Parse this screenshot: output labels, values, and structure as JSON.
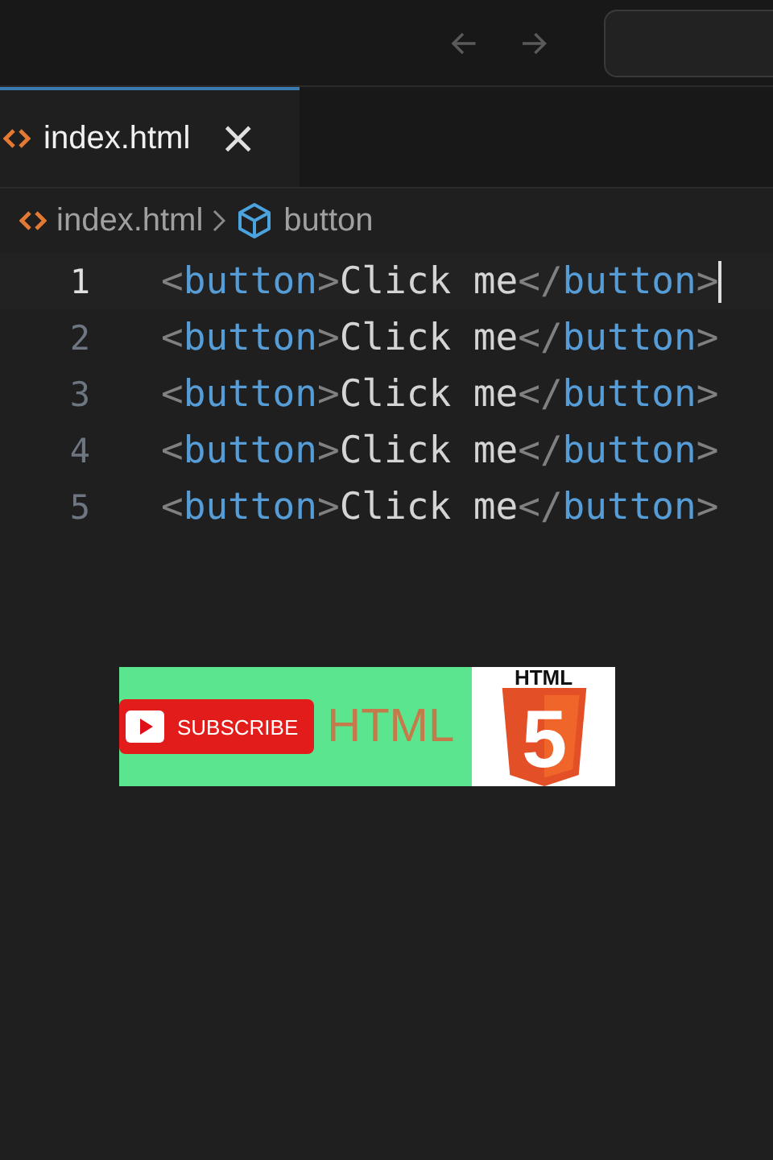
{
  "tab": {
    "label": "index.html",
    "selected": true,
    "close": "×"
  },
  "breadcrumb": {
    "file": "index.html",
    "symbol": "button"
  },
  "editor": {
    "lines": [
      {
        "number": "1",
        "active": true,
        "tokens": [
          {
            "kind": "punct",
            "text": "<"
          },
          {
            "kind": "tag",
            "text": "button"
          },
          {
            "kind": "punct",
            "text": ">"
          },
          {
            "kind": "text",
            "text": "Click me"
          },
          {
            "kind": "punct",
            "text": "</"
          },
          {
            "kind": "tag",
            "text": "button"
          },
          {
            "kind": "punct",
            "text": ">"
          }
        ]
      },
      {
        "number": "2",
        "active": false,
        "tokens": [
          {
            "kind": "punct",
            "text": "<"
          },
          {
            "kind": "tag",
            "text": "button"
          },
          {
            "kind": "punct",
            "text": ">"
          },
          {
            "kind": "text",
            "text": "Click me"
          },
          {
            "kind": "punct",
            "text": "</"
          },
          {
            "kind": "tag",
            "text": "button"
          },
          {
            "kind": "punct",
            "text": ">"
          }
        ]
      },
      {
        "number": "3",
        "active": false,
        "tokens": [
          {
            "kind": "punct",
            "text": "<"
          },
          {
            "kind": "tag",
            "text": "button"
          },
          {
            "kind": "punct",
            "text": ">"
          },
          {
            "kind": "text",
            "text": "Click me"
          },
          {
            "kind": "punct",
            "text": "</"
          },
          {
            "kind": "tag",
            "text": "button"
          },
          {
            "kind": "punct",
            "text": ">"
          }
        ]
      },
      {
        "number": "4",
        "active": false,
        "tokens": [
          {
            "kind": "punct",
            "text": "<"
          },
          {
            "kind": "tag",
            "text": "button"
          },
          {
            "kind": "punct",
            "text": ">"
          },
          {
            "kind": "text",
            "text": "Click me"
          },
          {
            "kind": "punct",
            "text": "</"
          },
          {
            "kind": "tag",
            "text": "button"
          },
          {
            "kind": "punct",
            "text": ">"
          }
        ]
      },
      {
        "number": "5",
        "active": false,
        "tokens": [
          {
            "kind": "punct",
            "text": "<"
          },
          {
            "kind": "tag",
            "text": "button"
          },
          {
            "kind": "punct",
            "text": ">"
          },
          {
            "kind": "text",
            "text": "Click me"
          },
          {
            "kind": "punct",
            "text": "</"
          },
          {
            "kind": "tag",
            "text": "button"
          },
          {
            "kind": "punct",
            "text": ">"
          }
        ]
      }
    ]
  },
  "banner": {
    "subscribe": "SUBSCRIBE",
    "title": "HTML",
    "logo_label": "HTML",
    "logo_number": "5"
  }
}
